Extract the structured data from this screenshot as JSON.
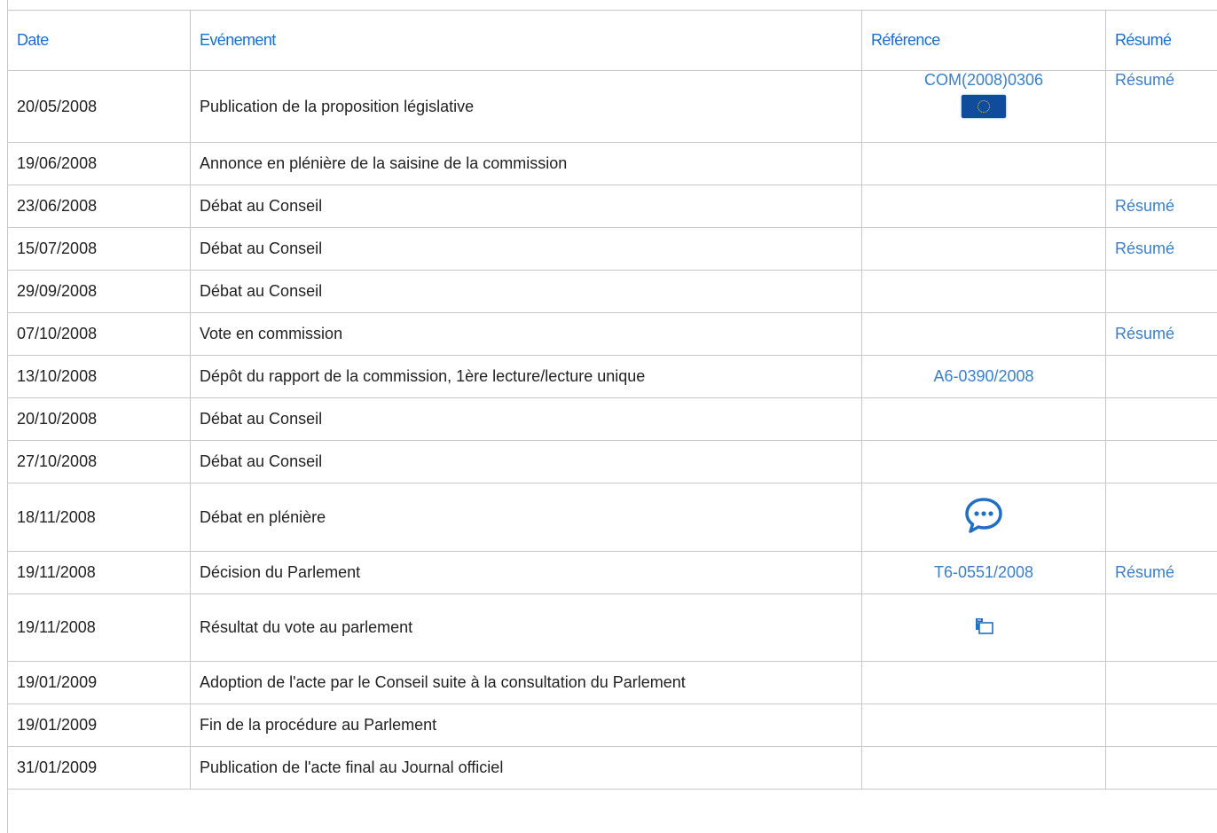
{
  "table": {
    "headers": {
      "date": "Date",
      "event": "Evénement",
      "reference": "Référence",
      "summary": "Résumé"
    },
    "rows": [
      {
        "date": "20/05/2008",
        "event": "Publication de la proposition législative",
        "reference": "COM(2008)0306",
        "reference_icon": "eu-flag-icon",
        "summary": "Résumé"
      },
      {
        "date": "19/06/2008",
        "event": "Annonce en plénière de la saisine de la commission",
        "reference": "",
        "summary": ""
      },
      {
        "date": "23/06/2008",
        "event": "Débat au Conseil",
        "reference": "",
        "summary": "Résumé"
      },
      {
        "date": "15/07/2008",
        "event": "Débat au Conseil",
        "reference": "",
        "summary": "Résumé"
      },
      {
        "date": "29/09/2008",
        "event": "Débat au Conseil",
        "reference": "",
        "summary": ""
      },
      {
        "date": "07/10/2008",
        "event": "Vote en commission",
        "reference": "",
        "summary": "Résumé"
      },
      {
        "date": "13/10/2008",
        "event": "Dépôt du rapport de la commission, 1ère lecture/lecture unique",
        "reference": "A6-0390/2008",
        "summary": ""
      },
      {
        "date": "20/10/2008",
        "event": "Débat au Conseil",
        "reference": "",
        "summary": ""
      },
      {
        "date": "27/10/2008",
        "event": "Débat au Conseil",
        "reference": "",
        "summary": ""
      },
      {
        "date": "18/11/2008",
        "event": "Débat en plénière",
        "reference": "",
        "reference_icon": "chat-bubble-icon",
        "summary": ""
      },
      {
        "date": "19/11/2008",
        "event": "Décision du Parlement",
        "reference": "T6-0551/2008",
        "summary": "Résumé"
      },
      {
        "date": "19/11/2008",
        "event": "Résultat du vote au parlement",
        "reference": "",
        "reference_icon": "vote-result-icon",
        "summary": ""
      },
      {
        "date": "19/01/2009",
        "event": "Adoption de l'acte par le Conseil suite à la consultation du Parlement",
        "reference": "",
        "summary": ""
      },
      {
        "date": "19/01/2009",
        "event": "Fin de la procédure au Parlement",
        "reference": "",
        "summary": ""
      },
      {
        "date": "31/01/2009",
        "event": "Publication de l'acte final au Journal officiel",
        "reference": "",
        "summary": ""
      }
    ]
  },
  "colors": {
    "link": "#3a7fc9",
    "header": "#1a6ed0",
    "border": "#c8c8c8",
    "icon_blue": "#1f6fc7"
  }
}
